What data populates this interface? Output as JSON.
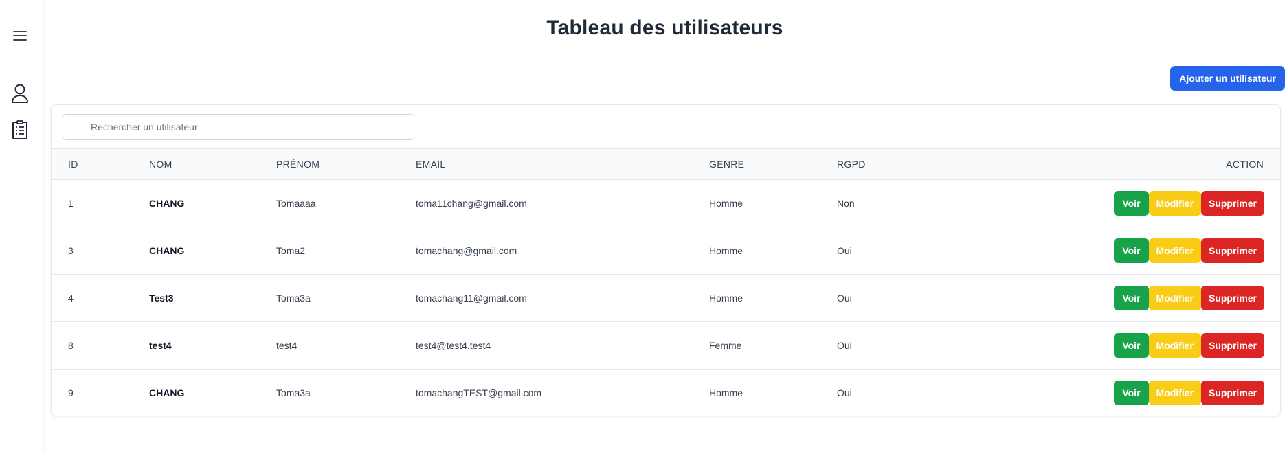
{
  "page": {
    "title": "Tableau des utilisateurs",
    "add_button": "Ajouter un utilisateur"
  },
  "sidebar": {
    "items": [
      {
        "icon": "menu-icon"
      },
      {
        "icon": "user-icon"
      },
      {
        "icon": "clipboard-list-icon"
      }
    ]
  },
  "search": {
    "placeholder": "Rechercher un utilisateur",
    "value": ""
  },
  "table": {
    "headers": {
      "id": "ID",
      "nom": "NOM",
      "prenom": "PRÉNOM",
      "email": "EMAIL",
      "genre": "GENRE",
      "rgpd": "RGPD",
      "action": "ACTION"
    },
    "rows": [
      {
        "id": "1",
        "nom": "CHANG",
        "prenom": "Tomaaaa",
        "email": "toma11chang@gmail.com",
        "genre": "Homme",
        "rgpd": "Non"
      },
      {
        "id": "3",
        "nom": "CHANG",
        "prenom": "Toma2",
        "email": "tomachang@gmail.com",
        "genre": "Homme",
        "rgpd": "Oui"
      },
      {
        "id": "4",
        "nom": "Test3",
        "prenom": "Toma3a",
        "email": "tomachang11@gmail.com",
        "genre": "Homme",
        "rgpd": "Oui"
      },
      {
        "id": "8",
        "nom": "test4",
        "prenom": "test4",
        "email": "test4@test4.test4",
        "genre": "Femme",
        "rgpd": "Oui"
      },
      {
        "id": "9",
        "nom": "CHANG",
        "prenom": "Toma3a",
        "email": "tomachangTEST@gmail.com",
        "genre": "Homme",
        "rgpd": "Oui"
      }
    ],
    "actions": {
      "view": "Voir",
      "edit": "Modifier",
      "delete": "Supprimer"
    }
  },
  "colors": {
    "primary": "#2563eb",
    "view": "#16a34a",
    "edit": "#facc15",
    "delete": "#dc2626"
  }
}
